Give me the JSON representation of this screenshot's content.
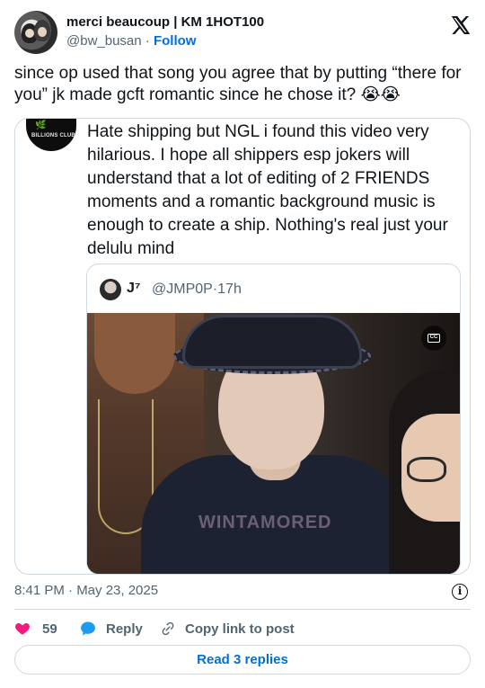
{
  "author": {
    "name": "merci beaucoup | KM 1HOT100",
    "handle": "@bw_busan",
    "separator": "·",
    "follow_label": "Follow"
  },
  "tweet": {
    "text": "since op used that song you agree that by putting “there for you” jk made gcft romantic since he chose it? 😭😭"
  },
  "quoted": {
    "avatar_text": "BILLIONS CLUB",
    "avatar_mark": "🌿",
    "text": "Hate shipping but NGL i found this video very hilarious. I hope all shippers esp jokers will understand that a lot of editing of 2 FRIENDS moments and a romantic background music is enough to create a ship. Nothing's real just your delulu mind",
    "inner": {
      "name": "J⁷",
      "handle_time": "@JMP0P·17h"
    },
    "video": {
      "cc_label": "CC",
      "shirt_text": "WINTAMORED"
    }
  },
  "meta": {
    "timestamp": "8:41 PM · May 23, 2025",
    "info_label": "i"
  },
  "actions": {
    "like_count": "59",
    "reply_label": "Reply",
    "copy_label": "Copy link to post"
  },
  "read_replies_label": "Read 3 replies",
  "colors": {
    "accent": "#006fd6",
    "like": "#f91880",
    "reply": "#1d9bf0",
    "muted": "#536471",
    "border": "#cfd9de"
  }
}
